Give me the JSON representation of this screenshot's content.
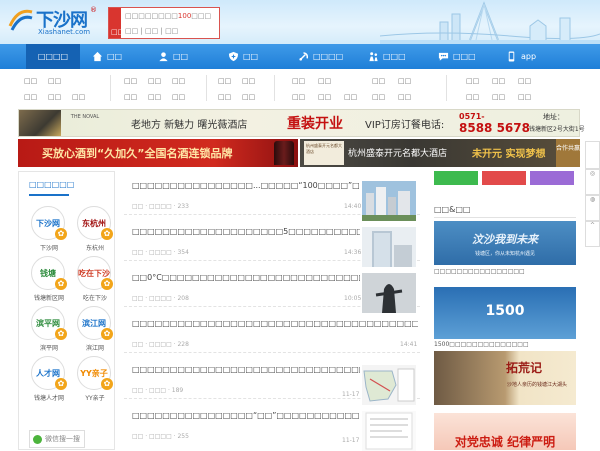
{
  "logo": {
    "word": "下沙网",
    "domain": "Xiashanet.com"
  },
  "login": {
    "line1_prefix": "□□□□□□□□",
    "line1_count": "100",
    "line1_suffix": "□□□",
    "line2": "□□ | □□ | □□",
    "side_label": "□□"
  },
  "nav": {
    "items": [
      {
        "label": "□□□□",
        "icon": "home-icon"
      },
      {
        "label": "□□",
        "icon": "home-icon"
      },
      {
        "label": "□□",
        "icon": "user-icon"
      },
      {
        "label": "□□",
        "icon": "shield-icon"
      },
      {
        "label": "□□□□",
        "icon": "party-icon"
      },
      {
        "label": "□□□",
        "icon": "people-icon"
      },
      {
        "label": "□□□",
        "icon": "chat-icon"
      },
      {
        "label": "app",
        "icon": "phone-icon"
      }
    ]
  },
  "subnav": {
    "col1": [
      "□□",
      "□□",
      "□□",
      "□□",
      "□□",
      "□□"
    ],
    "col2": [
      "□□",
      "□□",
      "□□",
      "□□",
      "□□",
      "□□"
    ],
    "col3": [
      "□□",
      "□□",
      "□□",
      "□□",
      "□□",
      "□□"
    ],
    "col4": [
      "□□",
      "□□",
      "□□",
      "□□",
      "□□",
      "□□"
    ],
    "col5": [
      "□□",
      "□□",
      "□□",
      "□□",
      "□□",
      "□□"
    ]
  },
  "ad1": {
    "brand": "THE NOVAL",
    "slogan": "老地方 新魅力 曙光薇酒店",
    "headline": "重装开业",
    "vip": "VIP订房订餐电话:",
    "phone_prefix": "0571-",
    "phone": "8588 5678",
    "addr_label": "地址：",
    "addr": "钱塘新区2号大街1号"
  },
  "ad2": {
    "text": "买放心酒到“久加久”全国名酒连锁品牌"
  },
  "ad3": {
    "mini": "杭州盛泰开元名都大酒店",
    "name": "杭州盛泰开元名都大酒店",
    "slogan": "未开元 实现梦想",
    "badge": "合作共赢"
  },
  "left": {
    "heading": "□□□□□□",
    "tiles": [
      {
        "caption": "下沙网",
        "logo": "下沙网"
      },
      {
        "caption": "东杭州",
        "logo": "东杭州"
      },
      {
        "caption": "钱塘新区网",
        "logo": "钱塘"
      },
      {
        "caption": "吃在下沙",
        "logo": "吃在下沙"
      },
      {
        "caption": "滨平网",
        "logo": "滨平网"
      },
      {
        "caption": "滨江网",
        "logo": "滨江网"
      },
      {
        "caption": "钱塘人才网",
        "logo": "人才网"
      },
      {
        "caption": "YY亲子",
        "logo": "YY亲子"
      }
    ],
    "wechat": "微信搜一搜"
  },
  "news": [
    {
      "title": "□□□□□□□□□□□□□□□□...□□□□□“100□□□□”□□□□pick□□□□",
      "meta": "□□ · □□□□ · 233",
      "time": "14:40"
    },
    {
      "title": "□□□□□□□□□□□□□□□□□□□□5□□□□□□□□□□□□□□□□□□□",
      "meta": "□□ · □□□□ · 354",
      "time": "14:36"
    },
    {
      "title": "□□0°C□□□□□□□□□□□□□□□□□□□□□□□□□□□□□□□□□□",
      "meta": "□□ · □□□□ · 208",
      "time": "10:05"
    },
    {
      "title": "□□□□□□□□□□□□□□□□□□□□□□□□□□□□□□□□□□□□□□□□",
      "meta": "□□ · □□□□ · 228",
      "time": "14:41"
    },
    {
      "title": "□□□□□□□□□□□□□□□□□□□□□□□□□□□□□□□□□□□□",
      "meta": "□□ · □□□ · 189",
      "time": "11-17"
    },
    {
      "title": "□□□□□□□□□□□□□□□□“□□”□□□□□□□□□□□□...□□□□□",
      "meta": "□□ · □□□□ · 255",
      "time": "11-17"
    }
  ],
  "right": {
    "heading": "□□&□□",
    "img1_title": "汶沙我到未来",
    "img1_sub": "钱塘区，你从未知杭州遇见",
    "caption1": "□□□□□□□□□□□□□□□□",
    "img2_title": "1500",
    "caption2": "1500□□□□□□□□□□□□□□",
    "img3_title": "拓荒记",
    "img3_sub": "沙地人亲历的钱塘江大湖头",
    "img4_title": "对党忠诚 纪律严明"
  },
  "colors": {
    "nav": "#2a86dc",
    "accent_red": "#c41111",
    "link": "#1a72c9"
  }
}
